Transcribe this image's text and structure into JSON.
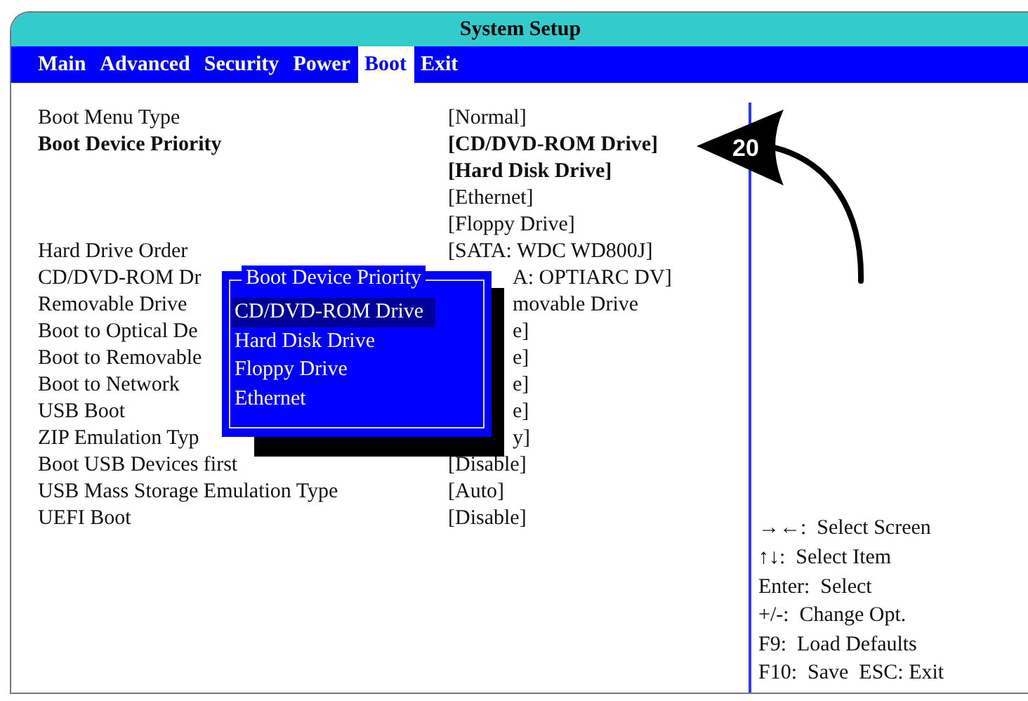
{
  "window": {
    "title": "System Setup"
  },
  "tabs": [
    {
      "label": "Main",
      "selected": false
    },
    {
      "label": "Advanced",
      "selected": false
    },
    {
      "label": "Security",
      "selected": false
    },
    {
      "label": "Power",
      "selected": false
    },
    {
      "label": "Boot",
      "selected": true
    },
    {
      "label": "Exit",
      "selected": false
    }
  ],
  "settings": [
    {
      "label": "Boot Menu Type",
      "emphasized": false,
      "values": [
        {
          "text": "[Normal]",
          "emphasized": false
        }
      ]
    },
    {
      "label": "Boot Device Priority",
      "emphasized": true,
      "values": [
        {
          "text": "[CD/DVD-ROM Drive]",
          "emphasized": true
        },
        {
          "text": "[Hard Disk Drive]",
          "emphasized": true
        },
        {
          "text": "[Ethernet]",
          "emphasized": false
        },
        {
          "text": "[Floppy Drive]",
          "emphasized": false
        }
      ]
    },
    {
      "label": "Hard Drive Order",
      "emphasized": false,
      "values": [
        {
          "text": "[SATA:  WDC WD800J]",
          "emphasized": false
        }
      ]
    },
    {
      "label": "CD/DVD-ROM Dr",
      "emphasized": false,
      "values": [
        {
          "text": "A:  OPTIARC DV]",
          "emphasized": false,
          "covered": true
        }
      ]
    },
    {
      "label": "Removable Drive",
      "emphasized": false,
      "values": [
        {
          "text": "movable Drive",
          "emphasized": false,
          "covered": true
        }
      ]
    },
    {
      "label": "Boot to Optical De",
      "emphasized": false,
      "values": [
        {
          "text": "e]",
          "emphasized": false,
          "covered": true
        }
      ]
    },
    {
      "label": "Boot to Removable",
      "emphasized": false,
      "values": [
        {
          "text": "e]",
          "emphasized": false,
          "covered": true
        }
      ]
    },
    {
      "label": "Boot to Network",
      "emphasized": false,
      "values": [
        {
          "text": "e]",
          "emphasized": false,
          "covered": true
        }
      ]
    },
    {
      "label": "USB Boot",
      "emphasized": false,
      "values": [
        {
          "text": "e]",
          "emphasized": false,
          "covered": true
        }
      ]
    },
    {
      "label": "ZIP Emulation Typ",
      "emphasized": false,
      "values": [
        {
          "text": "y]",
          "emphasized": false,
          "covered": true
        }
      ]
    },
    {
      "label": "Boot USB Devices first",
      "emphasized": false,
      "values": [
        {
          "text": "[Disable]",
          "emphasized": false
        }
      ]
    },
    {
      "label": "USB Mass Storage Emulation Type",
      "emphasized": false,
      "values": [
        {
          "text": "[Auto]",
          "emphasized": false
        }
      ]
    },
    {
      "label": "UEFI Boot",
      "emphasized": false,
      "values": [
        {
          "text": "[Disable]",
          "emphasized": false
        }
      ]
    }
  ],
  "popup": {
    "title": "Boot Device Priority",
    "items": [
      {
        "label": "CD/DVD-ROM Drive",
        "selected": true
      },
      {
        "label": "Hard Disk Drive",
        "selected": false
      },
      {
        "label": "Floppy Drive",
        "selected": false
      },
      {
        "label": "Ethernet",
        "selected": false
      }
    ]
  },
  "help": [
    "→←:  Select Screen",
    "↑↓:  Select Item",
    "Enter:  Select",
    "+/-:  Change Opt.",
    "F9:  Load Defaults",
    "F10:  Save  ESC: Exit"
  ],
  "callout": {
    "label": "20"
  }
}
